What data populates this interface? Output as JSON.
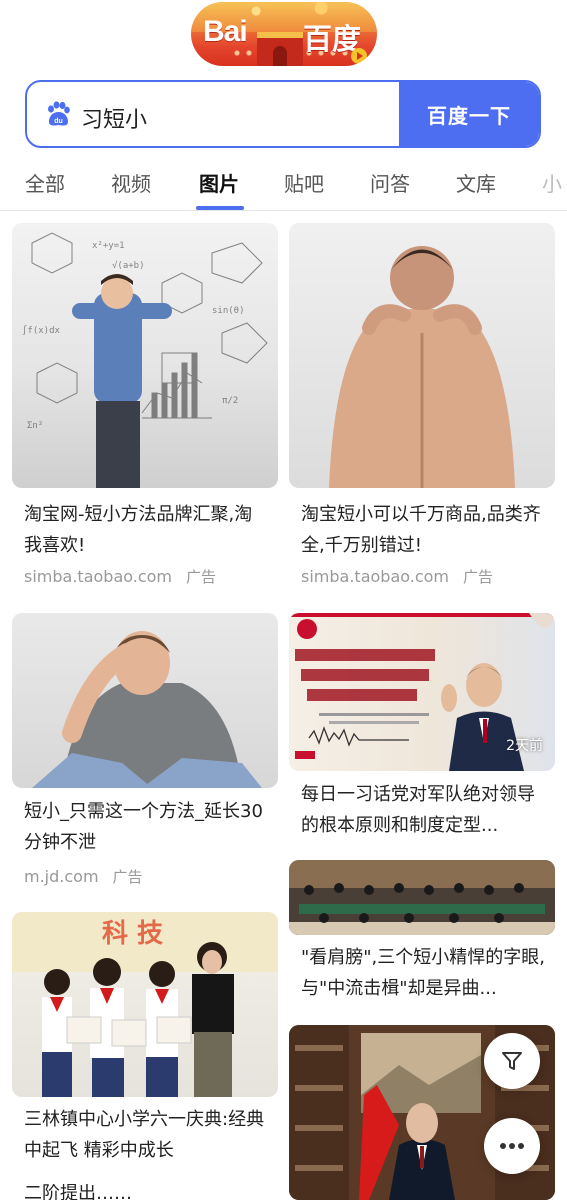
{
  "logo": {
    "text_latin": "Bai",
    "text_cn": "百度"
  },
  "search": {
    "query": "习短小",
    "button_label": "百度一下"
  },
  "tabs": [
    {
      "label": "全部"
    },
    {
      "label": "视频"
    },
    {
      "label": "图片"
    },
    {
      "label": "贴吧"
    },
    {
      "label": "问答"
    },
    {
      "label": "文库"
    },
    {
      "label": "小"
    }
  ],
  "active_tab": "图片",
  "results": [
    {
      "title": "淘宝网-短小方法品牌汇聚,淘我喜欢!",
      "source": "simba.taobao.com",
      "ad_label": "广告"
    },
    {
      "title": "淘宝短小可以千万商品,品类齐全,千万别错过!",
      "source": "simba.taobao.com",
      "ad_label": "广告"
    },
    {
      "title": "短小_只需这一个方法_延长30分钟不泄",
      "source": "m.jd.com",
      "ad_label": "广告"
    },
    {
      "title": "每日一习话党对军队绝对领导的根本原则和制度定型...",
      "time_badge": "2天前"
    },
    {
      "title": "\"看肩膀\",三个短小精悍的字眼,与\"中流击楫\"却是异曲..."
    },
    {
      "title": "三林镇中心小学六一庆典:经典中起飞 精彩中成长"
    },
    {
      "title": "二阶提出……"
    }
  ],
  "colors": {
    "brand_blue": "#4e6ef2",
    "text_dark": "#222222",
    "meta_gray": "#999999"
  },
  "icons": [
    "baidu-paw-icon",
    "filter-icon",
    "more-icon"
  ]
}
